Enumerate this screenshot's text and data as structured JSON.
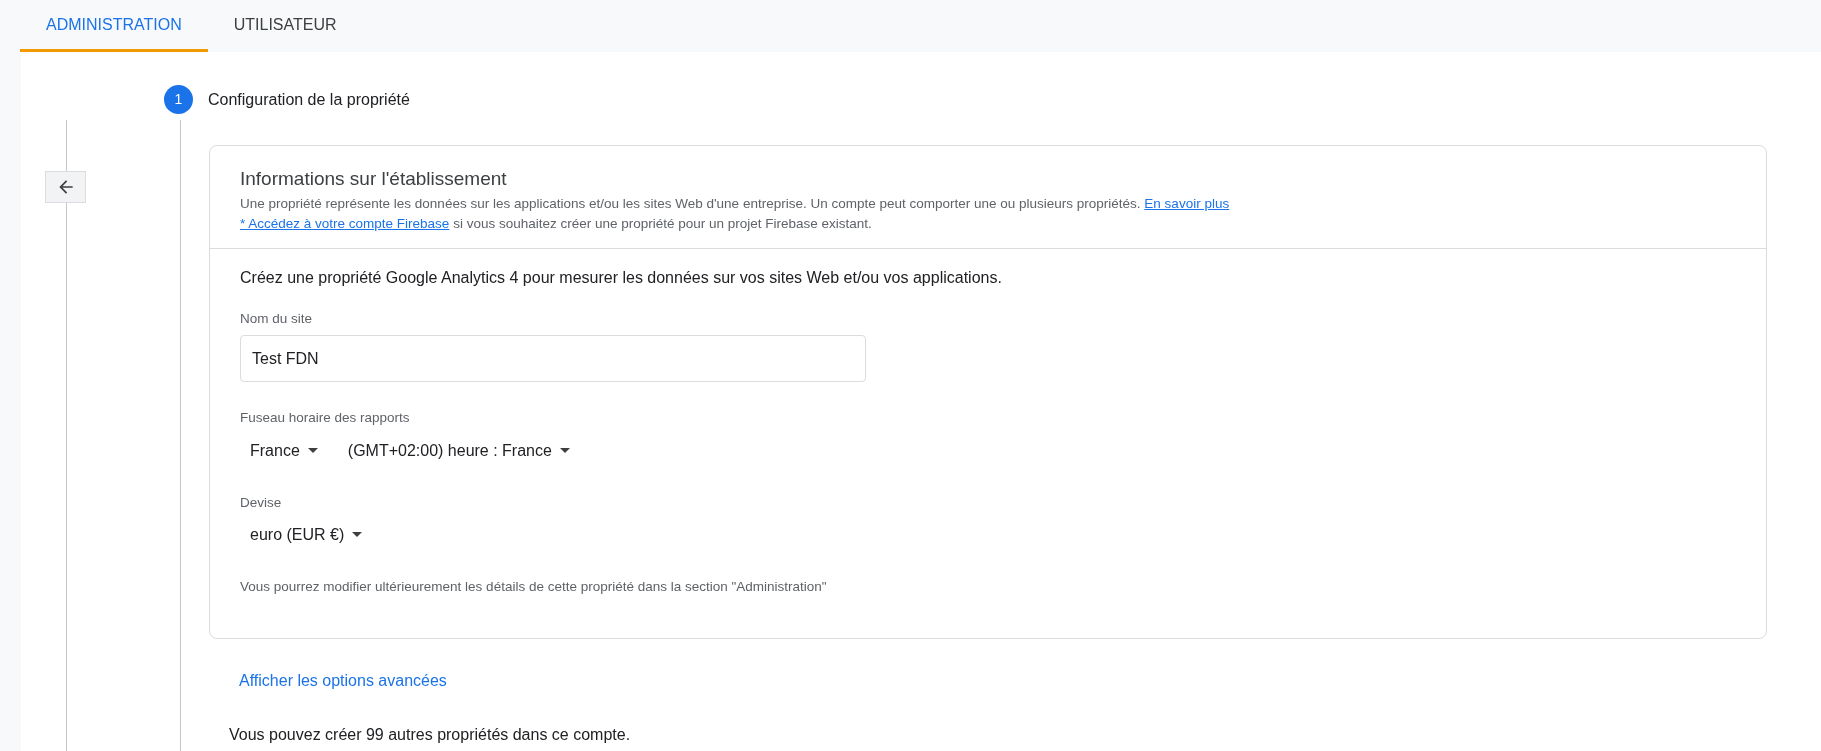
{
  "tabs": [
    {
      "label": "ADMINISTRATION",
      "selected": true
    },
    {
      "label": "UTILISATEUR",
      "selected": false
    }
  ],
  "step": {
    "number": "1",
    "title": "Configuration de la propriété",
    "active": true
  },
  "card": {
    "title": "Informations sur l'établissement",
    "description": "Une propriété représente les données sur les applications et/ou les sites Web d'une entreprise. Un compte peut comporter une ou plusieurs propriétés.",
    "learn_more_link": "En savoir plus",
    "firebase_link": "* Accédez à votre compte Firebase",
    "firebase_text": "si vous souhaitez créer une propriété pour un projet Firebase existant.",
    "intro": "Créez une propriété Google Analytics 4 pour mesurer les données sur vos sites Web et/ou vos applications.",
    "site_name": {
      "label": "Nom du site",
      "value": "Test FDN"
    },
    "timezone": {
      "label": "Fuseau horaire des rapports",
      "country": "France",
      "zone": "(GMT+02:00) heure : France"
    },
    "currency": {
      "label": "Devise",
      "value": "euro (EUR €)"
    },
    "note": "Vous pourrez modifier ultérieurement les détails de cette propriété dans la section \"Administration\""
  },
  "advanced_link": "Afficher les options avancées",
  "footer_note": "Vous pouvez créer 99 autres propriétés dans ce compte."
}
